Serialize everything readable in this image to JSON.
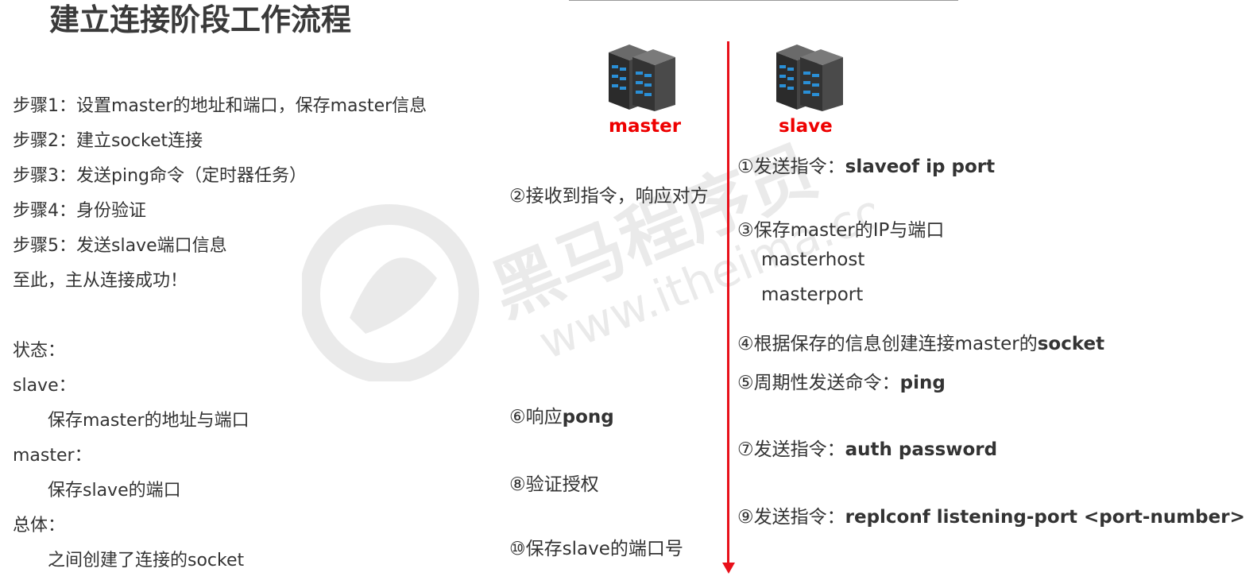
{
  "title": "建立连接阶段工作流程",
  "steps": [
    "步骤1：设置master的地址和端口，保存master信息",
    "步骤2：建立socket连接",
    "步骤3：发送ping命令（定时器任务）",
    "步骤4：身份验证",
    "步骤5：发送slave端口信息",
    "至此，主从连接成功！"
  ],
  "state": {
    "heading": "状态：",
    "slave_label": "slave：",
    "slave_detail": "保存master的地址与端口",
    "master_label": "master：",
    "master_detail": "保存slave的端口",
    "overall_label": "总体：",
    "overall_detail": "之间创建了连接的socket"
  },
  "roles": {
    "master": "master",
    "slave": "slave"
  },
  "slave_side": {
    "m1_prefix": "①发送指令：",
    "m1_cmd": "slaveof  ip  port",
    "m3": "③保存master的IP与端口",
    "m3_host": "masterhost",
    "m3_port": "masterport",
    "m4_prefix": "④根据保存的信息创建连接master的",
    "m4_bold": "socket",
    "m5_prefix": "⑤周期性发送命令：",
    "m5_cmd": "ping",
    "m7_prefix": "⑦发送指令：",
    "m7_cmd": "auth  password",
    "m9_prefix": "⑨发送指令：",
    "m9_cmd": "replconf listening-port <port-number>"
  },
  "master_side": {
    "m2": "②接收到指令，响应对方",
    "m6_prefix": "⑥响应",
    "m6_bold": "pong",
    "m8": "⑧验证授权",
    "m10": "⑩保存slave的端口号"
  },
  "colors": {
    "accent": "#e8101a",
    "label_red": "#ee0000",
    "text": "#333333"
  },
  "icons": [
    "server-icon"
  ]
}
